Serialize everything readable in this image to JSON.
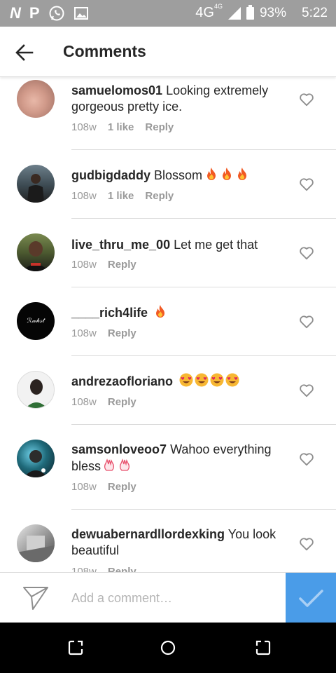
{
  "status_bar": {
    "network": "4G",
    "network_sup": "4G",
    "battery": "93%",
    "time": "5:22"
  },
  "header": {
    "title": "Comments"
  },
  "comments": [
    {
      "username": "samuelomos01",
      "text": "Looking extremely gorgeous pretty ice.",
      "time": "108w",
      "likes": "1 like",
      "reply": "Reply",
      "emojis": []
    },
    {
      "username": "gudbigdaddy",
      "text": "Blossom",
      "time": "108w",
      "likes": "1 like",
      "reply": "Reply",
      "emojis": [
        "fire",
        "fire",
        "fire"
      ]
    },
    {
      "username": "live_thru_me_00",
      "text": "Let me get that",
      "time": "108w",
      "reply": "Reply",
      "emojis": []
    },
    {
      "username": "____rich4life",
      "text": "",
      "time": "108w",
      "reply": "Reply",
      "emojis": [
        "fire"
      ]
    },
    {
      "username": "andrezaofloriano",
      "text": "",
      "time": "108w",
      "reply": "Reply",
      "emojis": [
        "heart-eyes",
        "heart-eyes",
        "heart-eyes",
        "heart-eyes"
      ]
    },
    {
      "username": "samsonloveoo7",
      "text": "Wahoo everything bless",
      "time": "108w",
      "reply": "Reply",
      "emojis": [
        "raised-hands",
        "raised-hands"
      ]
    },
    {
      "username": "dewuabernardllordexking",
      "text": "You look beautiful",
      "time": "108w",
      "reply": "Reply",
      "emojis": []
    }
  ],
  "avatars": {
    "c4_text": "ℛ𝓌𝒽𝓈𝓉"
  },
  "composer": {
    "placeholder": "Add a comment…"
  },
  "colors": {
    "accent": "#4a9ce8",
    "fire": "#f15a24",
    "heart_eyes": "#f7b733"
  }
}
